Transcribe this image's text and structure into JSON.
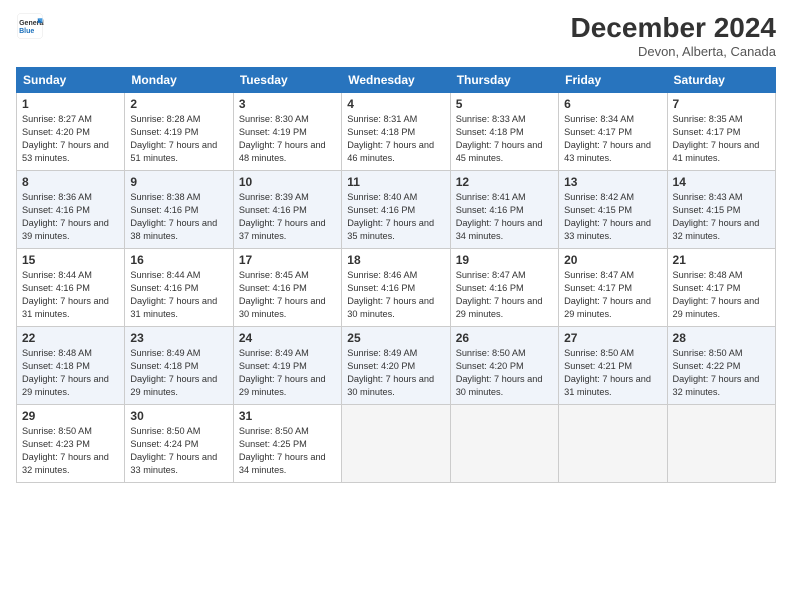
{
  "logo": {
    "line1": "General",
    "line2": "Blue"
  },
  "title": "December 2024",
  "location": "Devon, Alberta, Canada",
  "days_header": [
    "Sunday",
    "Monday",
    "Tuesday",
    "Wednesday",
    "Thursday",
    "Friday",
    "Saturday"
  ],
  "weeks": [
    [
      {
        "day": "1",
        "rise": "8:27 AM",
        "set": "4:20 PM",
        "daylight": "7 hours and 53 minutes."
      },
      {
        "day": "2",
        "rise": "8:28 AM",
        "set": "4:19 PM",
        "daylight": "7 hours and 51 minutes."
      },
      {
        "day": "3",
        "rise": "8:30 AM",
        "set": "4:19 PM",
        "daylight": "7 hours and 48 minutes."
      },
      {
        "day": "4",
        "rise": "8:31 AM",
        "set": "4:18 PM",
        "daylight": "7 hours and 46 minutes."
      },
      {
        "day": "5",
        "rise": "8:33 AM",
        "set": "4:18 PM",
        "daylight": "7 hours and 45 minutes."
      },
      {
        "day": "6",
        "rise": "8:34 AM",
        "set": "4:17 PM",
        "daylight": "7 hours and 43 minutes."
      },
      {
        "day": "7",
        "rise": "8:35 AM",
        "set": "4:17 PM",
        "daylight": "7 hours and 41 minutes."
      }
    ],
    [
      {
        "day": "8",
        "rise": "8:36 AM",
        "set": "4:16 PM",
        "daylight": "7 hours and 39 minutes."
      },
      {
        "day": "9",
        "rise": "8:38 AM",
        "set": "4:16 PM",
        "daylight": "7 hours and 38 minutes."
      },
      {
        "day": "10",
        "rise": "8:39 AM",
        "set": "4:16 PM",
        "daylight": "7 hours and 37 minutes."
      },
      {
        "day": "11",
        "rise": "8:40 AM",
        "set": "4:16 PM",
        "daylight": "7 hours and 35 minutes."
      },
      {
        "day": "12",
        "rise": "8:41 AM",
        "set": "4:16 PM",
        "daylight": "7 hours and 34 minutes."
      },
      {
        "day": "13",
        "rise": "8:42 AM",
        "set": "4:15 PM",
        "daylight": "7 hours and 33 minutes."
      },
      {
        "day": "14",
        "rise": "8:43 AM",
        "set": "4:15 PM",
        "daylight": "7 hours and 32 minutes."
      }
    ],
    [
      {
        "day": "15",
        "rise": "8:44 AM",
        "set": "4:16 PM",
        "daylight": "7 hours and 31 minutes."
      },
      {
        "day": "16",
        "rise": "8:44 AM",
        "set": "4:16 PM",
        "daylight": "7 hours and 31 minutes."
      },
      {
        "day": "17",
        "rise": "8:45 AM",
        "set": "4:16 PM",
        "daylight": "7 hours and 30 minutes."
      },
      {
        "day": "18",
        "rise": "8:46 AM",
        "set": "4:16 PM",
        "daylight": "7 hours and 30 minutes."
      },
      {
        "day": "19",
        "rise": "8:47 AM",
        "set": "4:16 PM",
        "daylight": "7 hours and 29 minutes."
      },
      {
        "day": "20",
        "rise": "8:47 AM",
        "set": "4:17 PM",
        "daylight": "7 hours and 29 minutes."
      },
      {
        "day": "21",
        "rise": "8:48 AM",
        "set": "4:17 PM",
        "daylight": "7 hours and 29 minutes."
      }
    ],
    [
      {
        "day": "22",
        "rise": "8:48 AM",
        "set": "4:18 PM",
        "daylight": "7 hours and 29 minutes."
      },
      {
        "day": "23",
        "rise": "8:49 AM",
        "set": "4:18 PM",
        "daylight": "7 hours and 29 minutes."
      },
      {
        "day": "24",
        "rise": "8:49 AM",
        "set": "4:19 PM",
        "daylight": "7 hours and 29 minutes."
      },
      {
        "day": "25",
        "rise": "8:49 AM",
        "set": "4:20 PM",
        "daylight": "7 hours and 30 minutes."
      },
      {
        "day": "26",
        "rise": "8:50 AM",
        "set": "4:20 PM",
        "daylight": "7 hours and 30 minutes."
      },
      {
        "day": "27",
        "rise": "8:50 AM",
        "set": "4:21 PM",
        "daylight": "7 hours and 31 minutes."
      },
      {
        "day": "28",
        "rise": "8:50 AM",
        "set": "4:22 PM",
        "daylight": "7 hours and 32 minutes."
      }
    ],
    [
      {
        "day": "29",
        "rise": "8:50 AM",
        "set": "4:23 PM",
        "daylight": "7 hours and 32 minutes."
      },
      {
        "day": "30",
        "rise": "8:50 AM",
        "set": "4:24 PM",
        "daylight": "7 hours and 33 minutes."
      },
      {
        "day": "31",
        "rise": "8:50 AM",
        "set": "4:25 PM",
        "daylight": "7 hours and 34 minutes."
      },
      null,
      null,
      null,
      null
    ]
  ]
}
